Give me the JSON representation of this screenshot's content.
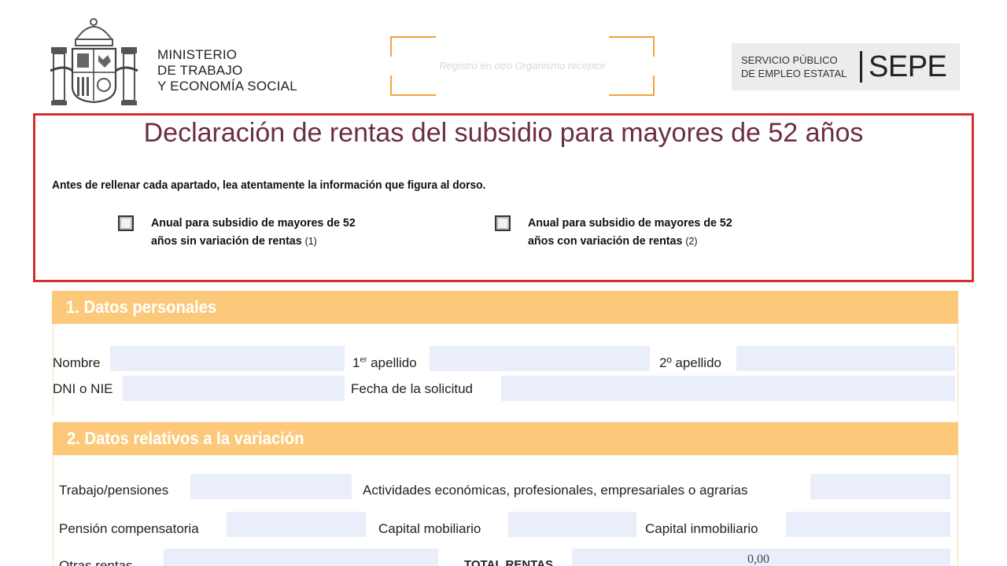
{
  "header": {
    "ministry_lines": [
      "MINISTERIO",
      "DE TRABAJO",
      "Y ECONOMÍA SOCIAL"
    ],
    "registro_label": "Registro en otro Organismo receptor",
    "sepe_small_lines": [
      "SERVICIO PÚBLICO",
      "DE EMPLEO ESTATAL"
    ],
    "sepe_logo": "SEPE"
  },
  "form": {
    "title": "Declaración de rentas del subsidio para mayores de 52 años",
    "instruction": "Antes de rellenar cada apartado, lea atentamente la información que figura al dorso.",
    "options": [
      {
        "line1": "Anual para subsidio de mayores de 52",
        "line2": "años sin variación de rentas",
        "note": "(1)"
      },
      {
        "line1": "Anual para subsidio de mayores de 52",
        "line2": "años con variación de rentas",
        "note": "(2)"
      }
    ]
  },
  "sections": {
    "personal": {
      "title": "1. Datos personales",
      "labels": {
        "nombre": "Nombre",
        "apellido1_prefix": "1",
        "apellido1_sup": "er",
        "apellido1_suffix": " apellido",
        "apellido2": "2º apellido",
        "dni": "DNI o NIE",
        "fecha": "Fecha de la solicitud"
      }
    },
    "variacion": {
      "title": "2. Datos relativos a la variación",
      "labels": {
        "trabajo": "Trabajo/pensiones",
        "actividades": "Actividades económicas, profesionales, empresariales o agrarias",
        "pension": "Pensión compensatoria",
        "capital_mob": "Capital mobiliario",
        "capital_inmob": "Capital inmobiliario",
        "otras": "Otras rentas",
        "total": "TOTAL RENTAS"
      },
      "total_value": "0,00"
    }
  },
  "colors": {
    "title": "#6b2d47",
    "section_header": "#fcc97a",
    "field_bg": "#e9eefa",
    "highlight_border": "#d32f2f",
    "registro_corner": "#f2a33a"
  }
}
